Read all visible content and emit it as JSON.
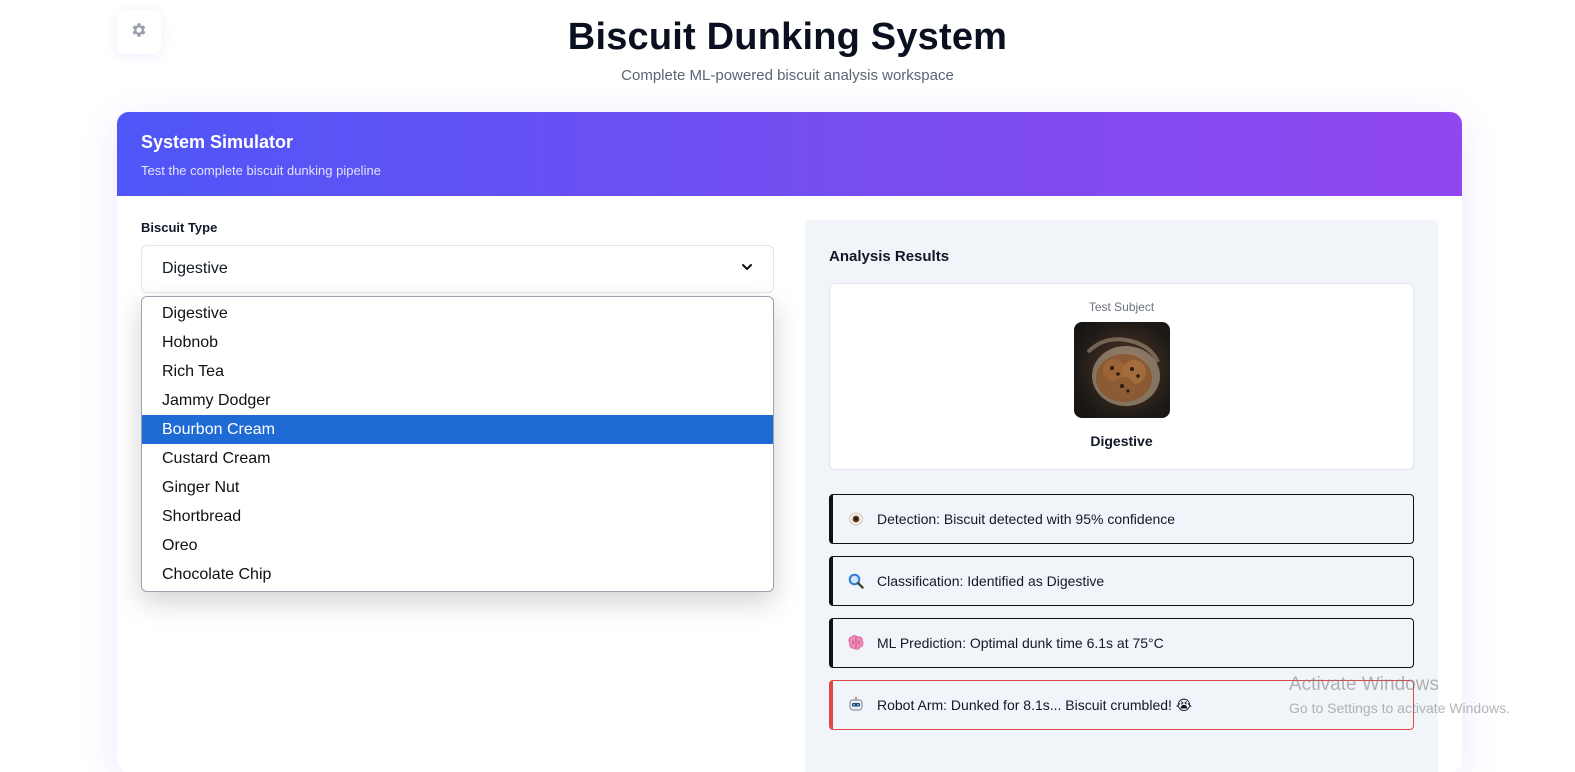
{
  "header": {
    "title": "Biscuit Dunking System",
    "subtitle": "Complete ML-powered biscuit analysis workspace"
  },
  "settings": {
    "icon": "gear-icon"
  },
  "simulator": {
    "title": "System Simulator",
    "subtitle": "Test the complete biscuit dunking pipeline",
    "biscuit_type_label": "Biscuit Type",
    "selected_value": "Digestive",
    "options": [
      "Digestive",
      "Hobnob",
      "Rich Tea",
      "Jammy Dodger",
      "Bourbon Cream",
      "Custard Cream",
      "Ginger Nut",
      "Shortbread",
      "Oreo",
      "Chocolate Chip"
    ],
    "highlighted_option": "Bourbon Cream"
  },
  "results": {
    "title": "Analysis Results",
    "subject_label": "Test Subject",
    "subject_name": "Digestive",
    "log": [
      {
        "icon": "eye-icon",
        "text": "Detection: Biscuit detected with 95% confidence",
        "status": "ok"
      },
      {
        "icon": "magnifier-icon",
        "text": "Classification: Identified as Digestive",
        "status": "ok"
      },
      {
        "icon": "brain-icon",
        "text": "ML Prediction: Optimal dunk time 6.1s at 75°C",
        "status": "ok"
      },
      {
        "icon": "robot-icon",
        "text": "Robot Arm: Dunked for 8.1s... Biscuit crumbled! 😭",
        "status": "error"
      }
    ]
  },
  "watermark": {
    "line1": "Activate Windows",
    "line2": "Go to Settings to activate Windows."
  },
  "colors": {
    "header_gradient_start": "#4f56f7",
    "header_gradient_end": "#9146ef",
    "option_highlight": "#1e6bd6",
    "error_border": "#e04848"
  }
}
